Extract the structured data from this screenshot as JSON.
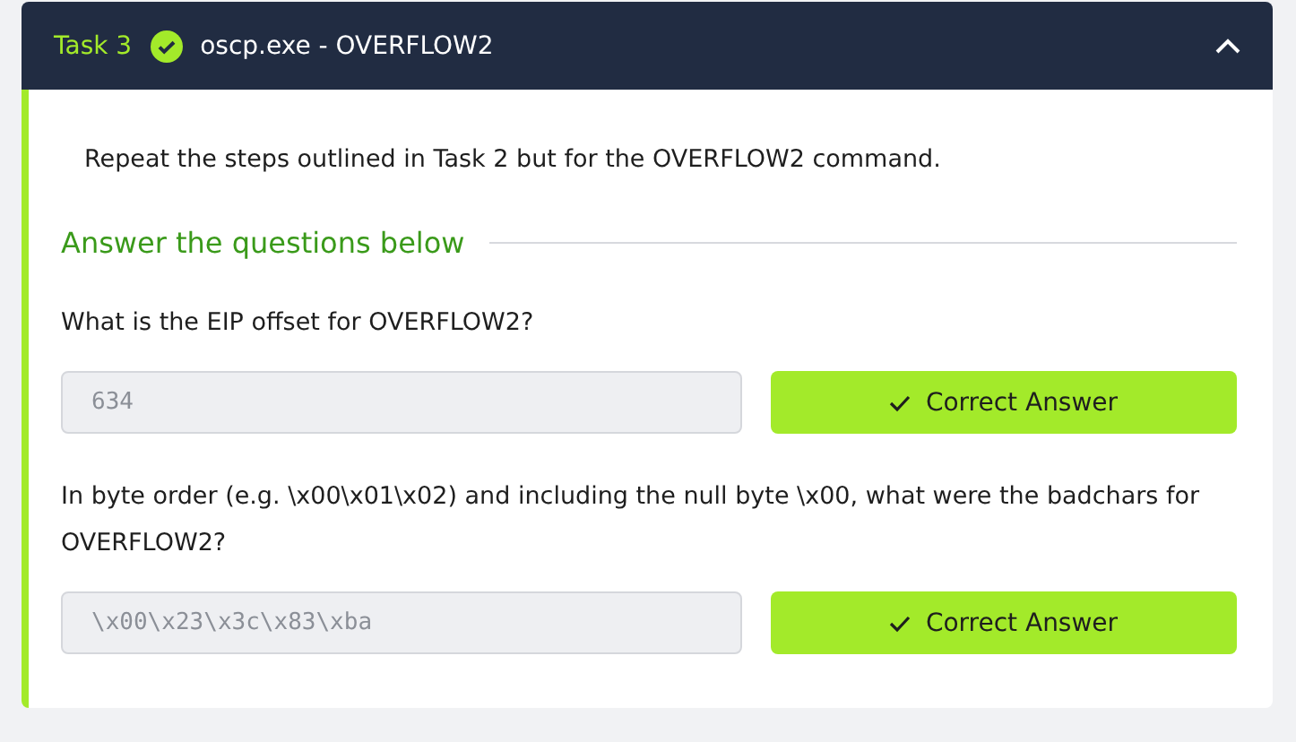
{
  "task": {
    "label": "Task 3",
    "completed": true,
    "title": "oscp.exe - OVERFLOW2",
    "expanded": true
  },
  "description": "Repeat the steps outlined in Task 2 but for the OVERFLOW2 command.",
  "answers_heading": "Answer the questions below",
  "questions": [
    {
      "question": "What is the EIP offset for OVERFLOW2?",
      "value": "634",
      "button": "Correct Answer",
      "correct": true
    },
    {
      "question": "In byte order (e.g. \\x00\\x01\\x02) and including the null byte \\x00, what were the badchars for OVERFLOW2?",
      "value": "\\x00\\x23\\x3c\\x83\\xba",
      "button": "Correct Answer",
      "correct": true
    }
  ]
}
